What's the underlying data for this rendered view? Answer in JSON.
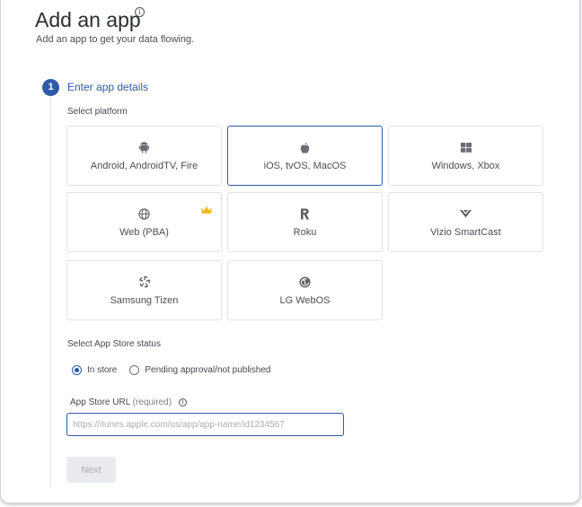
{
  "header": {
    "title": "Add an app",
    "info_icon": "info-icon",
    "subtitle": "Add an app to get your data flowing."
  },
  "step": {
    "number": "1",
    "title": "Enter app details"
  },
  "platform": {
    "label": "Select platform",
    "selected": "iOS, tvOS, MacOS",
    "tiles": [
      {
        "label": "Android, AndroidTV, Fire",
        "icon": "android-icon"
      },
      {
        "label": "iOS, tvOS, MacOS",
        "icon": "apple-icon"
      },
      {
        "label": "Windows, Xbox",
        "icon": "windows-icon"
      },
      {
        "label": "Web (PBA)",
        "icon": "globe-icon",
        "badge": "crown-icon"
      },
      {
        "label": "Roku",
        "icon": "roku-icon"
      },
      {
        "label": "Vizio SmartCast",
        "icon": "vizio-icon"
      },
      {
        "label": "Samsung Tizen",
        "icon": "tizen-icon"
      },
      {
        "label": "LG WebOS",
        "icon": "lg-icon"
      }
    ]
  },
  "store_status": {
    "label": "Select App Store status",
    "options": [
      "In store",
      "Pending approval/not published"
    ],
    "selected": "In store"
  },
  "url_field": {
    "label": "App Store URL",
    "required": "(required)",
    "placeholder": "https://itunes.apple.com/us/app/app-name/id1234567"
  },
  "actions": {
    "next_label": "Next"
  },
  "colors": {
    "accent": "#2f5aa8",
    "crown": "#f2b62c",
    "disabled_bg": "#e9ebee"
  }
}
